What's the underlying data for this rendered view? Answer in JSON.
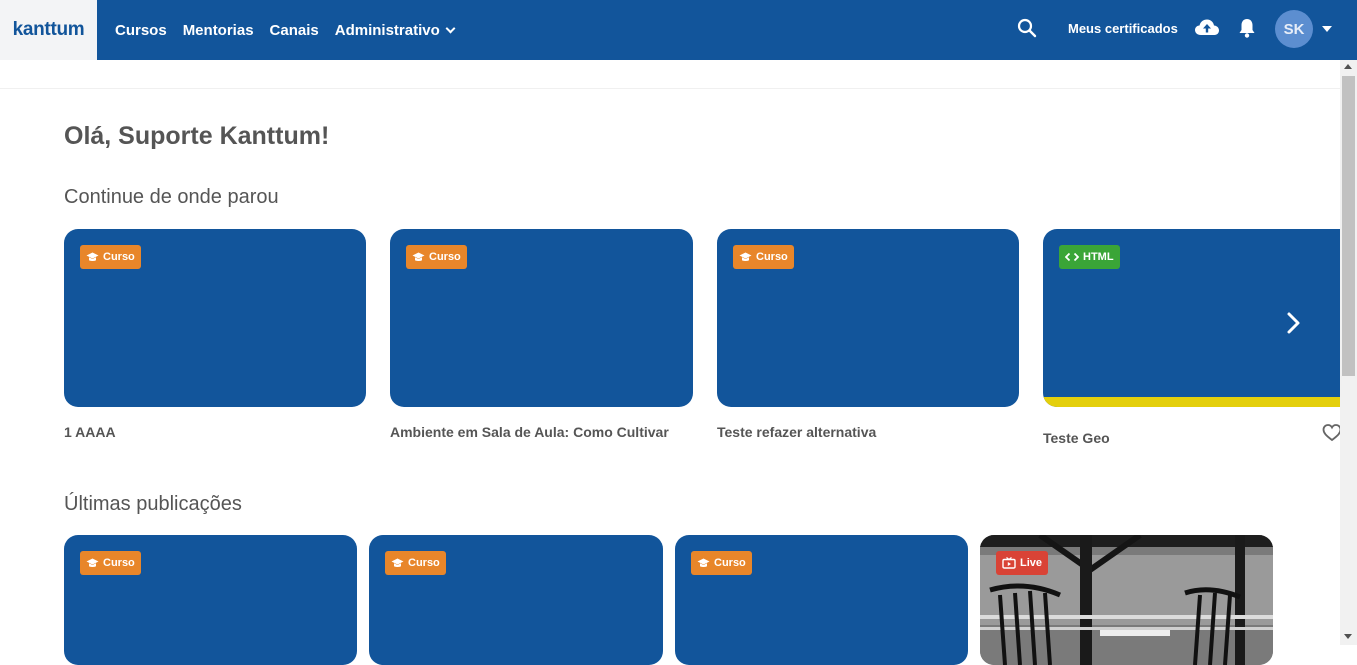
{
  "header": {
    "logo": "kanttum",
    "nav": [
      {
        "label": "Cursos"
      },
      {
        "label": "Mentorias"
      },
      {
        "label": "Canais"
      },
      {
        "label": "Administrativo"
      }
    ],
    "certificates_label": "Meus certificados",
    "avatar_initials": "SK",
    "colors": {
      "bar": "#12559b",
      "logo_bg": "#f3f4f6"
    }
  },
  "greeting": "Olá, Suporte Kanttum!",
  "continue_section": {
    "title": "Continue de onde parou",
    "cards": [
      {
        "badge": "Curso",
        "title": "1 AAAA"
      },
      {
        "badge": "Curso",
        "title": "Ambiente em Sala de Aula: Como Cultivar"
      },
      {
        "badge": "Curso",
        "title": "Teste refazer alternativa"
      },
      {
        "badge": "HTML",
        "title": "Teste Geo",
        "progress": 1.0
      }
    ]
  },
  "latest_section": {
    "title": "Últimas publicações",
    "cards": [
      {
        "badge": "Curso"
      },
      {
        "badge": "Curso"
      },
      {
        "badge": "Curso"
      },
      {
        "badge": "Live"
      }
    ]
  },
  "colors": {
    "card": "#12559b",
    "badge_curso": "#e8862a",
    "badge_html": "#3aa537",
    "badge_live": "#d94336",
    "progress": "#e4cf0c"
  }
}
